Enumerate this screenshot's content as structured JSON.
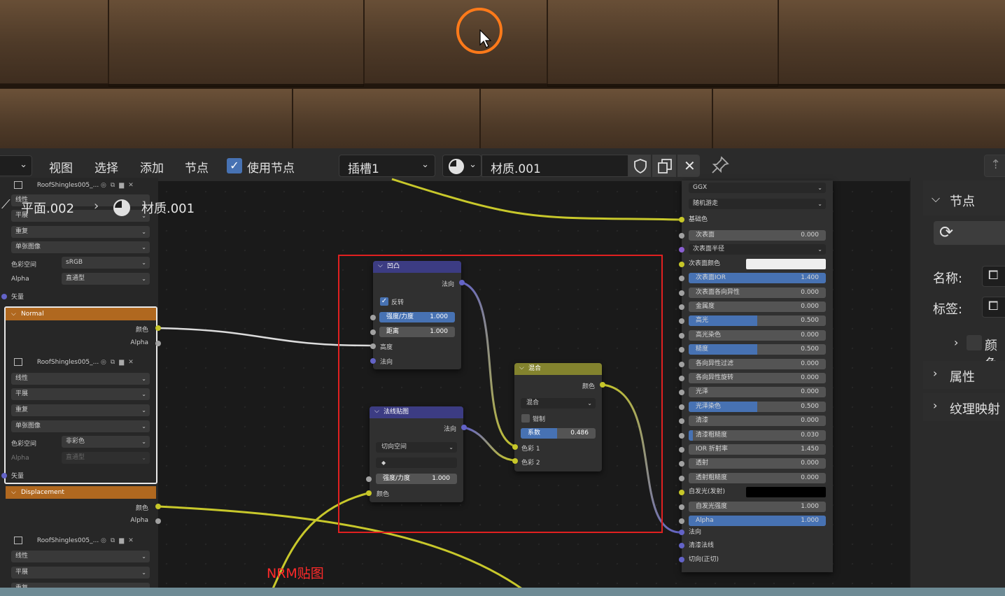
{
  "header": {
    "menus": [
      "视图",
      "选择",
      "添加",
      "节点"
    ],
    "use_nodes_label": "使用节点",
    "slot_label": "插槽1",
    "material_name": "材质.001"
  },
  "breadcrumb": {
    "object": "平面.002",
    "material": "材质.001"
  },
  "left_panel": {
    "top_texture": "RoofShingles005_...",
    "top_rows": [
      "线性",
      "平展",
      "重复",
      "单张图像"
    ],
    "top_colorspace_label": "色彩空间",
    "top_colorspace_value": "sRGB",
    "top_alpha_label": "Alpha",
    "top_alpha_value": "直通型",
    "top_vector": "矢量",
    "normal_frame": {
      "title": "Normal",
      "out_color": "颜色",
      "out_alpha": "Alpha",
      "texture": "RoofShingles005_...",
      "rows": [
        "线性",
        "平展",
        "重复",
        "单张图像"
      ],
      "colorspace_label": "色彩空间",
      "colorspace_value": "非彩色",
      "alpha_label": "Alpha",
      "alpha_value": "直通型",
      "vector": "矢量"
    },
    "displacement_frame": {
      "title": "Displacement",
      "out_color": "颜色",
      "out_alpha": "Alpha",
      "texture": "RoofShingles005_...",
      "rows": [
        "线性",
        "平展",
        "重复"
      ]
    }
  },
  "nodes": {
    "bump": {
      "title": "凹凸",
      "out_normal": "法向",
      "invert_label": "反转",
      "strength_label": "强度/力度",
      "strength_value": "1.000",
      "distance_label": "距离",
      "distance_value": "1.000",
      "in_height": "高度",
      "in_normal": "法向"
    },
    "normal_map": {
      "title": "法线贴图",
      "out_normal": "法向",
      "space": "切向空间",
      "strength_label": "强度/力度",
      "strength_value": "1.000",
      "in_color": "颜色"
    },
    "mix": {
      "title": "混合",
      "out_color": "颜色",
      "mode": "混合",
      "clamp_label": "钳制",
      "factor_label": "系数",
      "factor_value": "0.486",
      "factor_fraction": 0.486,
      "in_color1": "色彩 1",
      "in_color2": "色彩 2"
    }
  },
  "bsdf": {
    "distribution": "GGX",
    "subsurface_method": "随机游走",
    "base_color_label": "基础色",
    "rows": [
      {
        "label": "次表面",
        "value": "0.000",
        "fill": 0
      },
      {
        "label": "次表面半径",
        "value": "",
        "dropdown": true
      },
      {
        "label": "次表面颜色",
        "value": "",
        "swatch": "#eeeeee"
      },
      {
        "label": "次表面IOR",
        "value": "1.400",
        "fill": 1
      },
      {
        "label": "次表面各向异性",
        "value": "0.000",
        "fill": 0
      },
      {
        "label": "金属度",
        "value": "0.000",
        "fill": 0
      },
      {
        "label": "高光",
        "value": "0.500",
        "fill": 0.5
      },
      {
        "label": "高光染色",
        "value": "0.000",
        "fill": 0
      },
      {
        "label": "糙度",
        "value": "0.500",
        "fill": 0.5
      },
      {
        "label": "各向异性过滤",
        "value": "0.000",
        "fill": 0
      },
      {
        "label": "各向异性旋转",
        "value": "0.000",
        "fill": 0
      },
      {
        "label": "光泽",
        "value": "0.000",
        "fill": 0
      },
      {
        "label": "光泽染色",
        "value": "0.500",
        "fill": 0.5
      },
      {
        "label": "清漆",
        "value": "0.000",
        "fill": 0
      },
      {
        "label": "清漆粗糙度",
        "value": "0.030",
        "fill": 0.03
      },
      {
        "label": "IOR 折射率",
        "value": "1.450",
        "fill": 0
      },
      {
        "label": "透射",
        "value": "0.000",
        "fill": 0
      },
      {
        "label": "透射粗糙度",
        "value": "0.000",
        "fill": 0
      },
      {
        "label": "自发光(发射)",
        "value": "",
        "swatch": "#000000"
      },
      {
        "label": "自发光强度",
        "value": "1.000",
        "fill": 0
      },
      {
        "label": "Alpha",
        "value": "1.000",
        "fill": 1
      }
    ],
    "bottom_inputs": [
      "法向",
      "清漆法线",
      "切向(正切)"
    ]
  },
  "sidebar": {
    "node_section": "节点",
    "name_label": "名称:",
    "tag_label": "标签:",
    "color_label": "颜色",
    "properties_label": "属性",
    "texture_mapping_label": "纹理映射"
  },
  "annotation": {
    "text": "NRM贴图",
    "color": "#ff2a2a"
  },
  "colors": {
    "accent": "#4772b3",
    "socket_yellow": "#c7c729",
    "socket_blue": "#6363c7",
    "frame_orange": "#b0681f",
    "bump_header": "#3c3c83",
    "mix_header": "#83832e",
    "cursor_ring": "#ff7a1a"
  }
}
